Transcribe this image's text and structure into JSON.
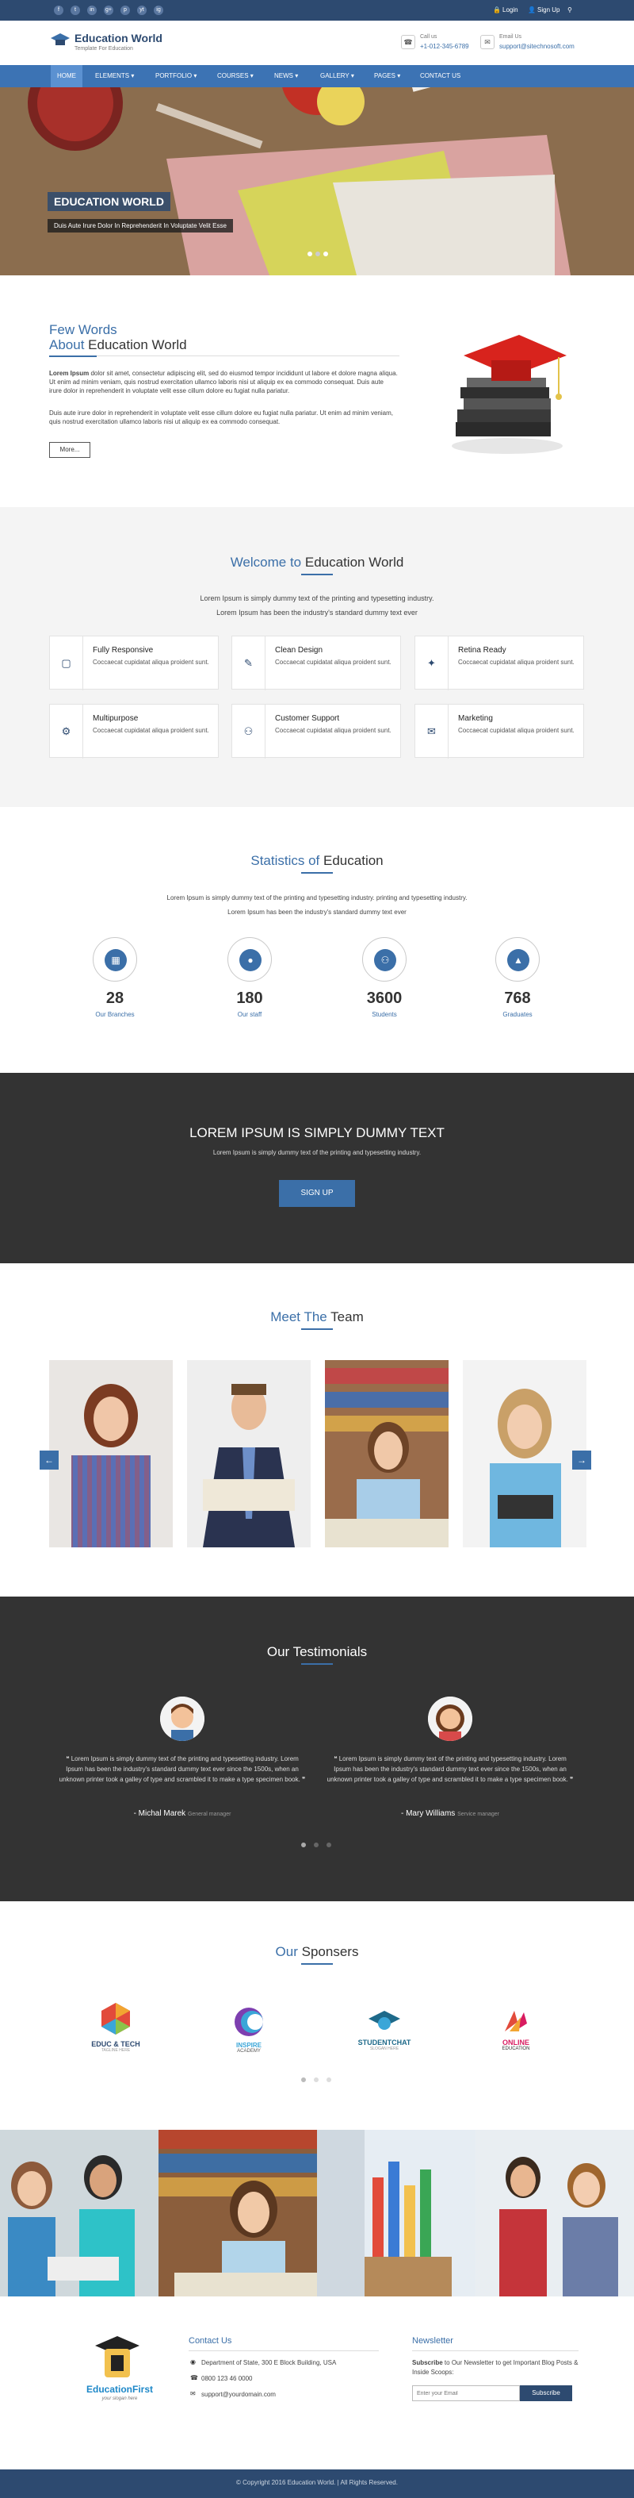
{
  "topbar": {
    "social": [
      "f",
      "t",
      "in",
      "g+",
      "p",
      "yt",
      "ig"
    ],
    "login": "Login",
    "signup": "Sign Up"
  },
  "header": {
    "brand": "Education World",
    "tagline": "Template For Education",
    "call_label": "Call us",
    "call_value": "+1-012-345-6789",
    "email_label": "Email Us",
    "email_value": "support@sitechnosoft.com"
  },
  "nav": {
    "items": [
      "HOME",
      "ELEMENTS",
      "PORTFOLIO",
      "COURSES",
      "NEWS",
      "GALLERY",
      "PAGES",
      "CONTACT US"
    ]
  },
  "hero": {
    "title": "EDUCATION WORLD",
    "subtitle": "Duis Aute Irure Dolor In Reprehenderit In Voluptate Velit Esse"
  },
  "about": {
    "title_line1": "Few Words",
    "title_a": "About",
    "title_b": "Education World",
    "lead": "Lorem Ipsum",
    "p1": "dolor sit amet, consectetur adipiscing elit, sed do eiusmod tempor incididunt ut labore et dolore magna aliqua. Ut enim ad minim veniam, quis nostrud exercitation ullamco laboris nisi ut aliquip ex ea commodo consequat. Duis aute irure dolor in reprehenderit in voluptate velit esse cillum dolore eu fugiat nulla pariatur.",
    "p2": "Duis aute irure dolor in reprehenderit in voluptate velit esse cillum dolore eu fugiat nulla pariatur. Ut enim ad minim veniam, quis nostrud exercitation ullamco laboris nisi ut aliquip ex ea commodo consequat.",
    "more": "More..."
  },
  "welcome": {
    "title_a": "Welcome to",
    "title_b": "Education World",
    "p1": "Lorem Ipsum is simply dummy text of the printing and typesetting industry.",
    "p2": "Lorem Ipsum has been the industry's standard dummy text ever",
    "cards": [
      {
        "title": "Fully Responsive",
        "desc": "Coccaecat cupidatat aliqua proident sunt."
      },
      {
        "title": "Clean Design",
        "desc": "Coccaecat cupidatat aliqua proident sunt."
      },
      {
        "title": "Retina Ready",
        "desc": "Coccaecat cupidatat aliqua proident sunt."
      },
      {
        "title": "Multipurpose",
        "desc": "Coccaecat cupidatat aliqua proident sunt."
      },
      {
        "title": "Customer Support",
        "desc": "Coccaecat cupidatat aliqua proident sunt."
      },
      {
        "title": "Marketing",
        "desc": "Coccaecat cupidatat aliqua proident sunt."
      }
    ]
  },
  "stats": {
    "title_a": "Statistics of",
    "title_b": "Education",
    "p1": "Lorem Ipsum is simply dummy text of the printing and typesetting industry. printing and typesetting industry.",
    "p2": "Lorem Ipsum has been the industry's standard dummy text ever",
    "items": [
      {
        "num": "28",
        "label": "Our Branches"
      },
      {
        "num": "180",
        "label": "Our staff"
      },
      {
        "num": "3600",
        "label": "Students"
      },
      {
        "num": "768",
        "label": "Graduates"
      }
    ]
  },
  "cta": {
    "title": "LOREM IPSUM IS SIMPLY DUMMY TEXT",
    "text": "Lorem Ipsum is simply dummy text of the printing and typesetting industry.",
    "button": "SIGN UP"
  },
  "team": {
    "title_a": "Meet The",
    "title_b": "Team"
  },
  "testimonials": {
    "title": "Our Testimonials",
    "items": [
      {
        "quote": "Lorem Ipsum is simply dummy text of the printing and typesetting industry. Lorem Ipsum has been the industry's standard dummy text ever since the 1500s, when an unknown printer took a galley of type and scrambled it to make a type specimen book.",
        "name": "- Michal Marek",
        "role": "General manager"
      },
      {
        "quote": "Lorem Ipsum is simply dummy text of the printing and typesetting industry. Lorem Ipsum has been the industry's standard dummy text ever since the 1500s, when an unknown printer took a galley of type and scrambled it to make a type specimen book.",
        "name": "- Mary Williams",
        "role": "Service manager"
      }
    ]
  },
  "sponsors": {
    "title_a": "Our",
    "title_b": "Sponsers",
    "logos": [
      {
        "name": "EDUC & TECH",
        "sub": "TAGLINE HERE"
      },
      {
        "name": "INSPIRE",
        "sub": "ACADEMY"
      },
      {
        "name": "STUDENTCHAT",
        "sub": "SLOGAN HERE"
      },
      {
        "name": "ONLINE",
        "sub": "EDUCATION"
      }
    ]
  },
  "footer": {
    "logo_text": "EducationFirst",
    "logo_tagline": "your slogan here",
    "contact_title": "Contact Us",
    "address": "Department of State, 300 E Block Building, USA",
    "phone": "0800 123 46 0000",
    "email": "support@yourdomain.com",
    "newsletter_title": "Newsletter",
    "newsletter_lead": "Subscribe",
    "newsletter_text": "to Our Newsletter to get Important Blog Posts & Inside Scoops:",
    "email_placeholder": "Enter your Email",
    "subscribe": "Subscribe"
  },
  "copyright": "© Copyright 2016 Education World. | All Rights Reserved.",
  "colors": {
    "primary": "#3b6fa8",
    "dark": "#2d4a70",
    "section_dark": "#333333"
  }
}
